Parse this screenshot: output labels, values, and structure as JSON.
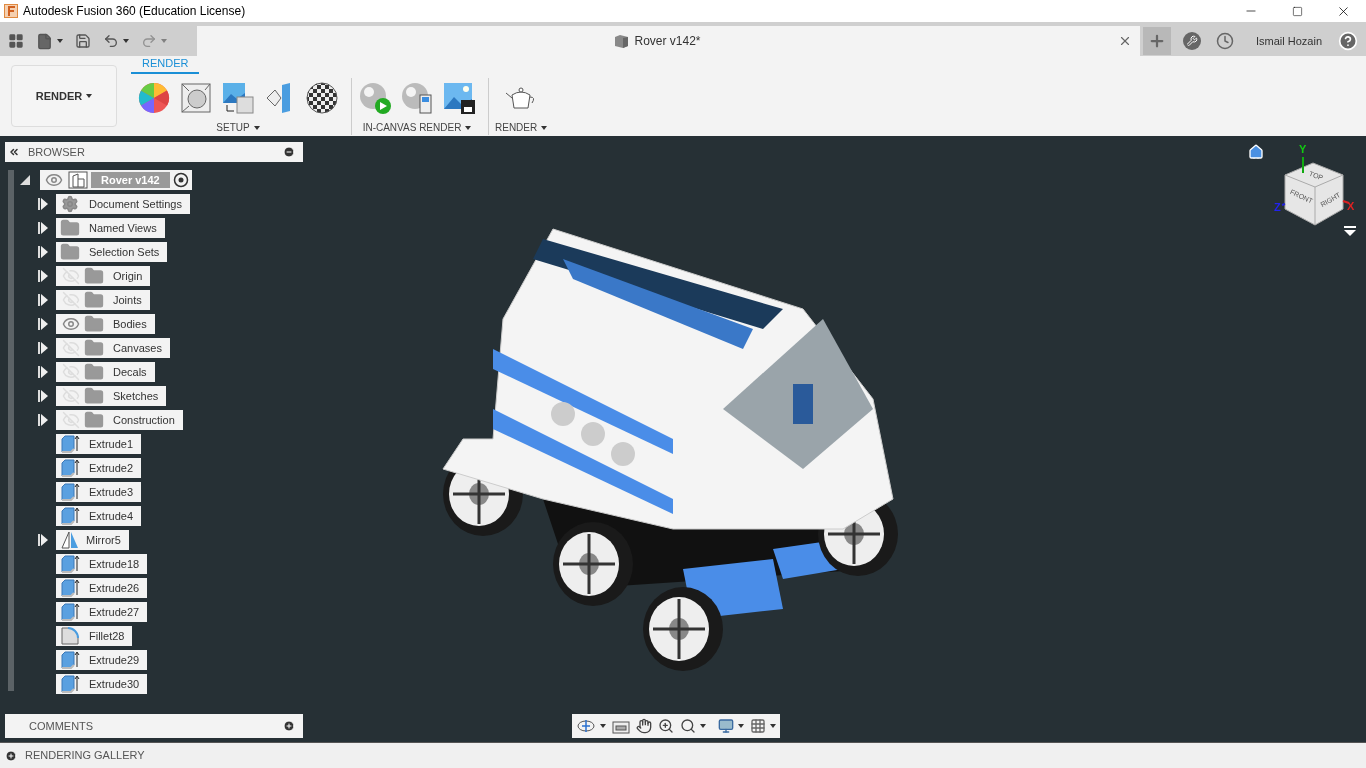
{
  "window": {
    "title": "Autodesk Fusion 360 (Education License)"
  },
  "document_tab": {
    "title": "Rover v142*"
  },
  "user": {
    "name": "Ismail Hozain"
  },
  "workspace": {
    "label": "RENDER"
  },
  "ribbon_tabs": [
    {
      "label": "RENDER",
      "selected": true
    }
  ],
  "ribbon_groups": [
    {
      "label": "SETUP"
    },
    {
      "label": "IN-CANVAS RENDER"
    },
    {
      "label": "RENDER"
    }
  ],
  "browser": {
    "title": "BROWSER",
    "root": {
      "label": "Rover v142",
      "expanded": true,
      "visible": true,
      "children": [
        {
          "label": "Document Settings",
          "kind": "settings",
          "expandable": true
        },
        {
          "label": "Named Views",
          "kind": "folder",
          "expandable": true
        },
        {
          "label": "Selection Sets",
          "kind": "folder",
          "expandable": true
        },
        {
          "label": "Origin",
          "kind": "folder",
          "expandable": true,
          "visible": false
        },
        {
          "label": "Joints",
          "kind": "folder",
          "expandable": true,
          "visible": false
        },
        {
          "label": "Bodies",
          "kind": "folder",
          "expandable": true,
          "visible": true
        },
        {
          "label": "Canvases",
          "kind": "folder",
          "expandable": true,
          "visible": false
        },
        {
          "label": "Decals",
          "kind": "folder",
          "expandable": true,
          "visible": false
        },
        {
          "label": "Sketches",
          "kind": "folder",
          "expandable": true,
          "visible": false
        },
        {
          "label": "Construction",
          "kind": "folder",
          "expandable": true,
          "visible": false
        },
        {
          "label": "Extrude1",
          "kind": "extrude",
          "expandable": false
        },
        {
          "label": "Extrude2",
          "kind": "extrude",
          "expandable": false
        },
        {
          "label": "Extrude3",
          "kind": "extrude",
          "expandable": false
        },
        {
          "label": "Extrude4",
          "kind": "extrude",
          "expandable": false
        },
        {
          "label": "Mirror5",
          "kind": "mirror",
          "expandable": true
        },
        {
          "label": "Extrude18",
          "kind": "extrude",
          "expandable": false
        },
        {
          "label": "Extrude26",
          "kind": "extrude",
          "expandable": false
        },
        {
          "label": "Extrude27",
          "kind": "extrude",
          "expandable": false
        },
        {
          "label": "Fillet28",
          "kind": "fillet",
          "expandable": false
        },
        {
          "label": "Extrude29",
          "kind": "extrude",
          "expandable": false
        },
        {
          "label": "Extrude30",
          "kind": "extrude",
          "expandable": false
        }
      ]
    }
  },
  "viewcube": {
    "faces": [
      "TOP",
      "FRONT",
      "RIGHT"
    ],
    "axes": [
      "Y",
      "Z",
      "X"
    ]
  },
  "comments": {
    "title": "COMMENTS"
  },
  "gallery": {
    "title": "RENDERING GALLERY"
  }
}
